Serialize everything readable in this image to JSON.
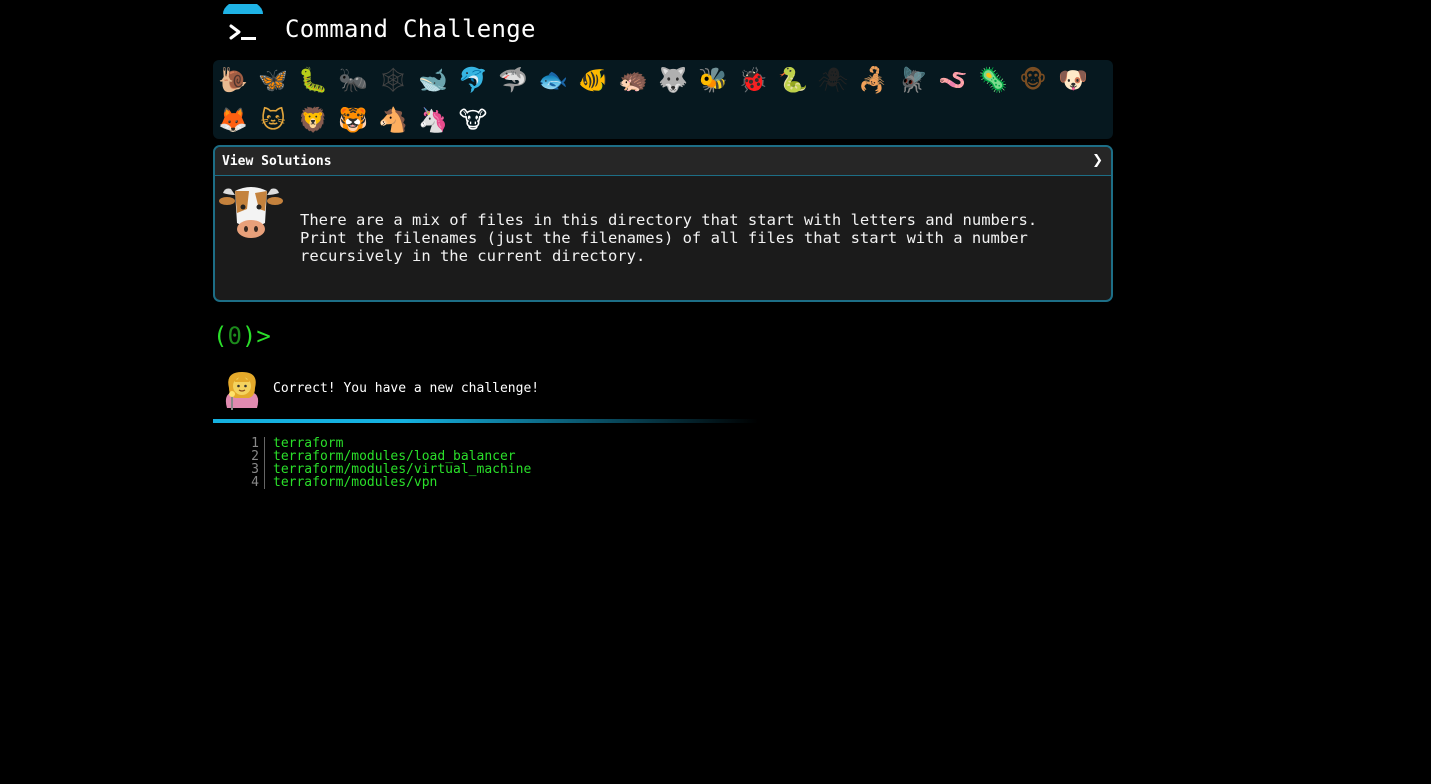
{
  "header": {
    "title": "Command Challenge",
    "logo_icon": "terminal-prompt-icon"
  },
  "animals": [
    {
      "name": "snail",
      "glyph": "🐌",
      "color": "#8b6a3a"
    },
    {
      "name": "butterfly",
      "glyph": "🦋",
      "color": "#e0781e"
    },
    {
      "name": "caterpillar",
      "glyph": "🐛",
      "color": "#6bb52f"
    },
    {
      "name": "ant",
      "glyph": "🐜",
      "color": "#2b2b2b"
    },
    {
      "name": "spider-web",
      "glyph": "🕸",
      "color": "#444"
    },
    {
      "name": "whale",
      "glyph": "🐋",
      "color": "#4a8fc1"
    },
    {
      "name": "dolphin",
      "glyph": "🐬",
      "color": "#3a8fc8"
    },
    {
      "name": "shark",
      "glyph": "🦈",
      "color": "#6f8795"
    },
    {
      "name": "fish",
      "glyph": "🐟",
      "color": "#5aa9d6"
    },
    {
      "name": "tropical-fish",
      "glyph": "🐠",
      "color": "#e8c22a"
    },
    {
      "name": "hedgehog",
      "glyph": "🦔",
      "color": "#7b5a33"
    },
    {
      "name": "wolf",
      "glyph": "🐺",
      "color": "#6b6b6b"
    },
    {
      "name": "bee",
      "glyph": "🐝",
      "color": "#f2c53d"
    },
    {
      "name": "ladybug",
      "glyph": "🐞",
      "color": "#c8242c"
    },
    {
      "name": "worm",
      "glyph": "🐍",
      "color": "#3aa33a"
    },
    {
      "name": "spider",
      "glyph": "🕷",
      "color": "#222"
    },
    {
      "name": "scorpion",
      "glyph": "🦂",
      "color": "#b22d2d"
    },
    {
      "name": "fly",
      "glyph": "🪰",
      "color": "#9a9a9a"
    },
    {
      "name": "earthworm",
      "glyph": "🪱",
      "color": "#d3679e"
    },
    {
      "name": "microbe",
      "glyph": "🦠",
      "color": "#5c8fc8"
    },
    {
      "name": "monkey",
      "glyph": "🐵",
      "color": "#7a4d22"
    },
    {
      "name": "dog",
      "glyph": "🐶",
      "color": "#d49a2a"
    },
    {
      "name": "fox",
      "glyph": "🦊",
      "color": "#d85c23"
    },
    {
      "name": "cat",
      "glyph": "🐱",
      "color": "#e2a53c"
    },
    {
      "name": "lion",
      "glyph": "🦁",
      "color": "#d89a32"
    },
    {
      "name": "tiger",
      "glyph": "🐯",
      "color": "#e07a1f"
    },
    {
      "name": "horse",
      "glyph": "🐴",
      "color": "#7a4f27"
    },
    {
      "name": "unicorn",
      "glyph": "🦄",
      "color": "#eaeaea"
    },
    {
      "name": "cow",
      "glyph": "🐮",
      "color": "#ffffff"
    }
  ],
  "panel": {
    "header_label": "View Solutions",
    "chevron": "❯",
    "challenge_text": "There are a mix of files in this directory that start with letters and numbers.\nPrint the filenames (just the filenames) of all files that start with a number\nrecursively in the current directory."
  },
  "prompt": {
    "open": "(",
    "count": "0",
    "close": ")>"
  },
  "result": {
    "message": "Correct! You have a new challenge!"
  },
  "output": [
    {
      "num": "1",
      "text": "terraform"
    },
    {
      "num": "2",
      "text": "terraform/modules/load_balancer"
    },
    {
      "num": "3",
      "text": "terraform/modules/virtual_machine"
    },
    {
      "num": "4",
      "text": "terraform/modules/vpn"
    }
  ]
}
